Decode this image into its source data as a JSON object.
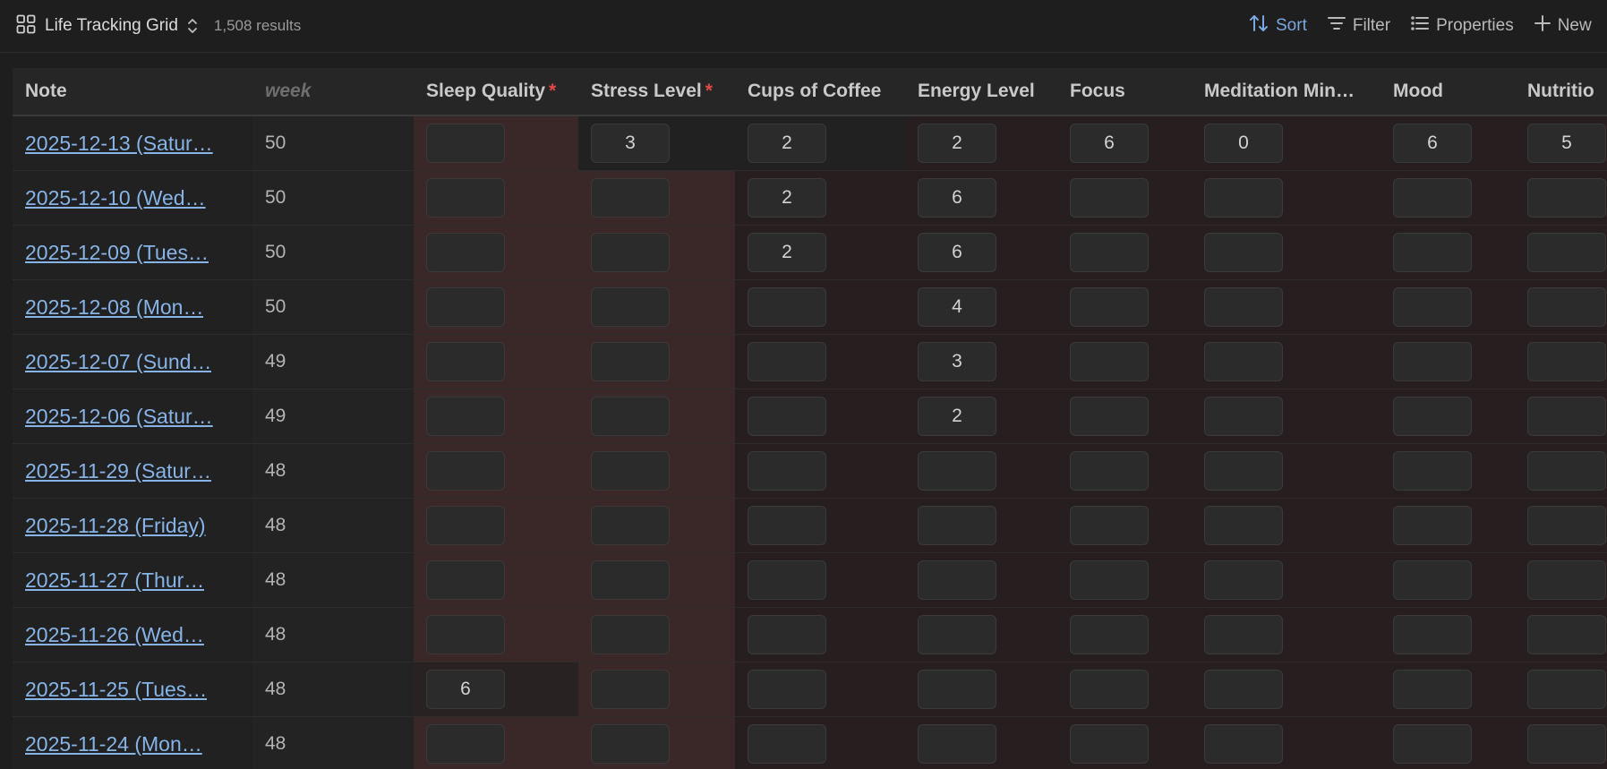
{
  "toolbar": {
    "view_name": "Life Tracking Grid",
    "results": "1,508 results",
    "sort_label": "Sort",
    "filter_label": "Filter",
    "properties_label": "Properties",
    "new_label": "New"
  },
  "columns": {
    "note": "Note",
    "week": "week",
    "sleep": "Sleep Quality",
    "stress": "Stress Level",
    "cups": "Cups of Coffee",
    "energy": "Energy Level",
    "focus": "Focus",
    "meditation": "Meditation Min…",
    "mood": "Mood",
    "nutrition": "Nutritio",
    "required_mark": "*"
  },
  "rows": [
    {
      "note": "2025-12-13 (Satur…",
      "week": "50",
      "sleep": "",
      "stress": "3",
      "cups": "2",
      "energy": "2",
      "focus": "6",
      "meditation": "0",
      "mood": "6",
      "nutrition": "5"
    },
    {
      "note": "2025-12-10 (Wed…",
      "week": "50",
      "sleep": "",
      "stress": "",
      "cups": "2",
      "energy": "6",
      "focus": "",
      "meditation": "",
      "mood": "",
      "nutrition": ""
    },
    {
      "note": "2025-12-09 (Tues…",
      "week": "50",
      "sleep": "",
      "stress": "",
      "cups": "2",
      "energy": "6",
      "focus": "",
      "meditation": "",
      "mood": "",
      "nutrition": ""
    },
    {
      "note": "2025-12-08 (Mon…",
      "week": "50",
      "sleep": "",
      "stress": "",
      "cups": "",
      "energy": "4",
      "focus": "",
      "meditation": "",
      "mood": "",
      "nutrition": ""
    },
    {
      "note": "2025-12-07 (Sund…",
      "week": "49",
      "sleep": "",
      "stress": "",
      "cups": "",
      "energy": "3",
      "focus": "",
      "meditation": "",
      "mood": "",
      "nutrition": ""
    },
    {
      "note": "2025-12-06 (Satur…",
      "week": "49",
      "sleep": "",
      "stress": "",
      "cups": "",
      "energy": "2",
      "focus": "",
      "meditation": "",
      "mood": "",
      "nutrition": ""
    },
    {
      "note": "2025-11-29 (Satur…",
      "week": "48",
      "sleep": "",
      "stress": "",
      "cups": "",
      "energy": "",
      "focus": "",
      "meditation": "",
      "mood": "",
      "nutrition": ""
    },
    {
      "note": "2025-11-28 (Friday)",
      "week": "48",
      "sleep": "",
      "stress": "",
      "cups": "",
      "energy": "",
      "focus": "",
      "meditation": "",
      "mood": "",
      "nutrition": ""
    },
    {
      "note": "2025-11-27 (Thur…",
      "week": "48",
      "sleep": "",
      "stress": "",
      "cups": "",
      "energy": "",
      "focus": "",
      "meditation": "",
      "mood": "",
      "nutrition": ""
    },
    {
      "note": "2025-11-26 (Wed…",
      "week": "48",
      "sleep": "",
      "stress": "",
      "cups": "",
      "energy": "",
      "focus": "",
      "meditation": "",
      "mood": "",
      "nutrition": ""
    },
    {
      "note": "2025-11-25 (Tues…",
      "week": "48",
      "sleep": "6",
      "stress": "",
      "cups": "",
      "energy": "",
      "focus": "",
      "meditation": "",
      "mood": "",
      "nutrition": ""
    },
    {
      "note": "2025-11-24 (Mon…",
      "week": "48",
      "sleep": "",
      "stress": "",
      "cups": "",
      "energy": "",
      "focus": "",
      "meditation": "",
      "mood": "",
      "nutrition": ""
    }
  ]
}
